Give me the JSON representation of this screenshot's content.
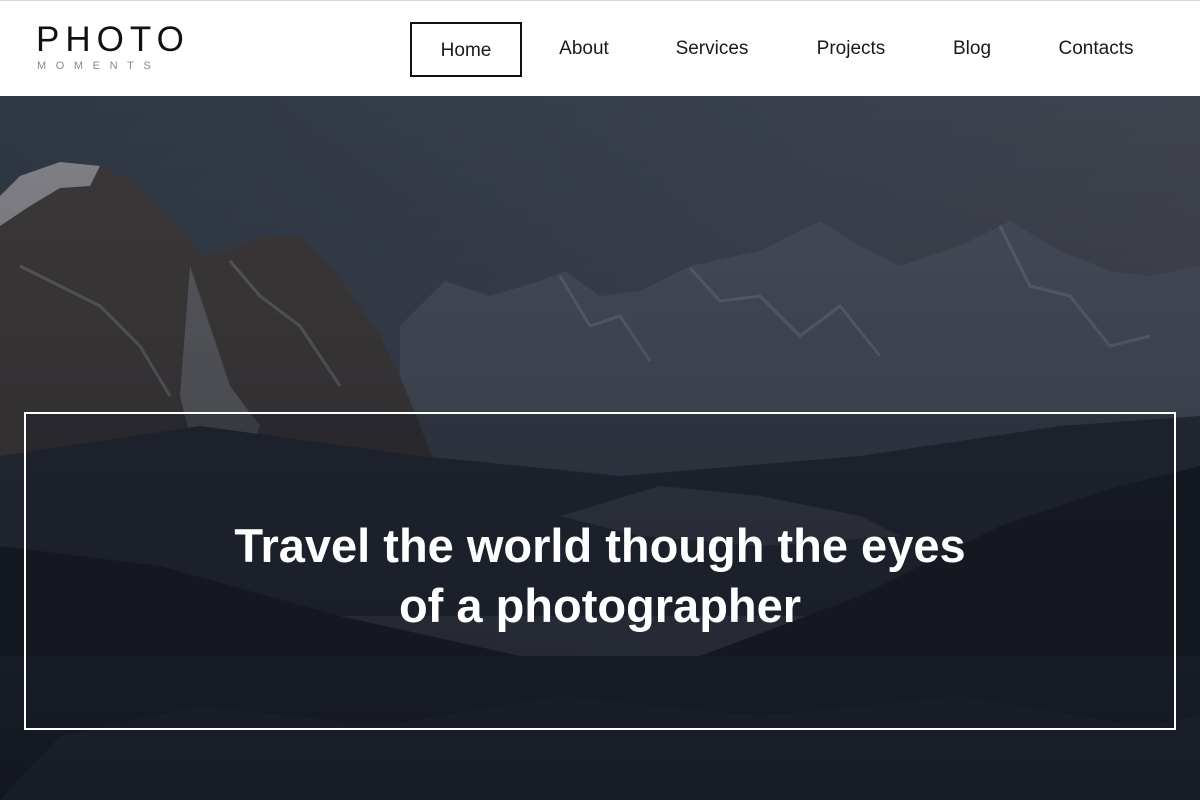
{
  "brand": {
    "name": "PHOTO",
    "tagline": "MOMENTS"
  },
  "nav": {
    "active": "Home",
    "items": [
      {
        "label": "Home"
      },
      {
        "label": "About"
      },
      {
        "label": "Services"
      },
      {
        "label": "Projects"
      },
      {
        "label": "Blog"
      },
      {
        "label": "Contacts"
      }
    ]
  },
  "hero": {
    "headline_line1": "Travel the world though the eyes",
    "headline_line2": "of a photographer",
    "image_subject": "mountain-lake-landscape"
  },
  "colors": {
    "header_bg": "#ffffff",
    "nav_text": "#1a1a1a",
    "active_border": "#111111",
    "hero_overlay": "#161924",
    "caption_text": "#ffffff"
  }
}
